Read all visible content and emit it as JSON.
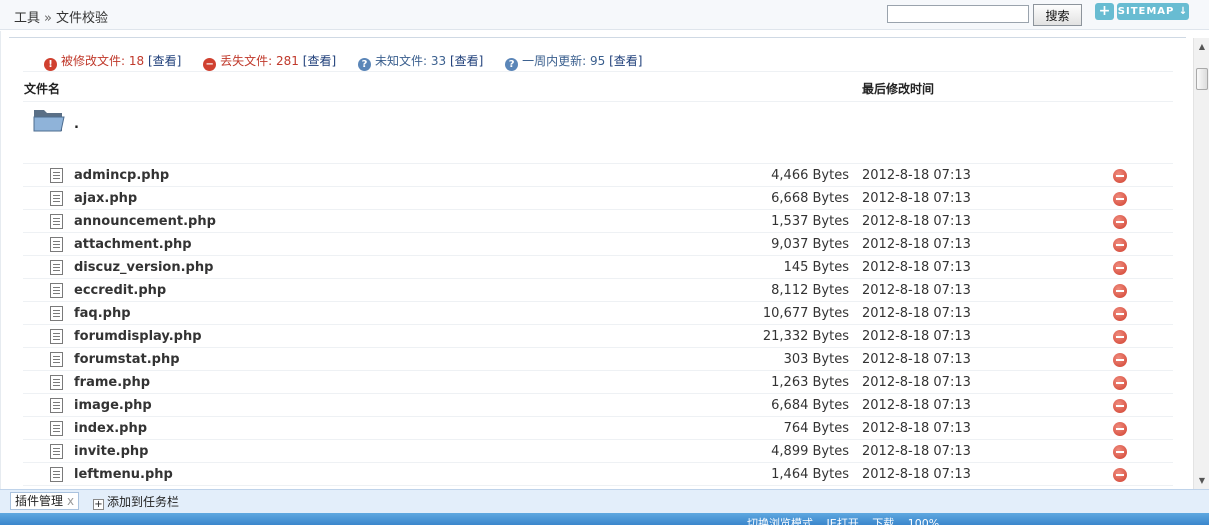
{
  "breadcrumb": {
    "root": "工具",
    "separator": "»",
    "current": "文件校验"
  },
  "search": {
    "value": "",
    "button_label": "搜索"
  },
  "top_buttons": {
    "plus": "+",
    "sitemap": "SITEMAP ↓"
  },
  "stats": {
    "modified": {
      "label": "被修改文件: 18",
      "link": "[查看]"
    },
    "missing": {
      "label": "丢失文件: 281",
      "link": "[查看]"
    },
    "unknown": {
      "label": "未知文件: 33",
      "link": "[查看]"
    },
    "recent": {
      "label": "一周内更新: 95",
      "link": "[查看]"
    }
  },
  "columns": {
    "filename": "文件名",
    "modified": "最后修改时间"
  },
  "folder": {
    "name": "."
  },
  "files": [
    {
      "name": "admincp.php",
      "size": "4,466 Bytes",
      "date": "2012-8-18 07:13"
    },
    {
      "name": "ajax.php",
      "size": "6,668 Bytes",
      "date": "2012-8-18 07:13"
    },
    {
      "name": "announcement.php",
      "size": "1,537 Bytes",
      "date": "2012-8-18 07:13"
    },
    {
      "name": "attachment.php",
      "size": "9,037 Bytes",
      "date": "2012-8-18 07:13"
    },
    {
      "name": "discuz_version.php",
      "size": "145 Bytes",
      "date": "2012-8-18 07:13"
    },
    {
      "name": "eccredit.php",
      "size": "8,112 Bytes",
      "date": "2012-8-18 07:13"
    },
    {
      "name": "faq.php",
      "size": "10,677 Bytes",
      "date": "2012-8-18 07:13"
    },
    {
      "name": "forumdisplay.php",
      "size": "21,332 Bytes",
      "date": "2012-8-18 07:13"
    },
    {
      "name": "forumstat.php",
      "size": "303 Bytes",
      "date": "2012-8-18 07:13"
    },
    {
      "name": "frame.php",
      "size": "1,263 Bytes",
      "date": "2012-8-18 07:13"
    },
    {
      "name": "image.php",
      "size": "6,684 Bytes",
      "date": "2012-8-18 07:13"
    },
    {
      "name": "index.php",
      "size": "764 Bytes",
      "date": "2012-8-18 07:13"
    },
    {
      "name": "invite.php",
      "size": "4,899 Bytes",
      "date": "2012-8-18 07:13"
    },
    {
      "name": "leftmenu.php",
      "size": "1,464 Bytes",
      "date": "2012-8-18 07:13"
    }
  ],
  "pluginbar": {
    "tab_label": "插件管理",
    "tab_close": "x",
    "add_label": "添加到任务栏",
    "add_icon": "+"
  },
  "statusbar": {
    "items": [
      "切换浏览模式",
      "IE打开",
      "下载",
      "100%"
    ]
  },
  "colors": {
    "danger": "#d0402f",
    "info": "#3a5f8e",
    "accent": "#68bcd2"
  }
}
